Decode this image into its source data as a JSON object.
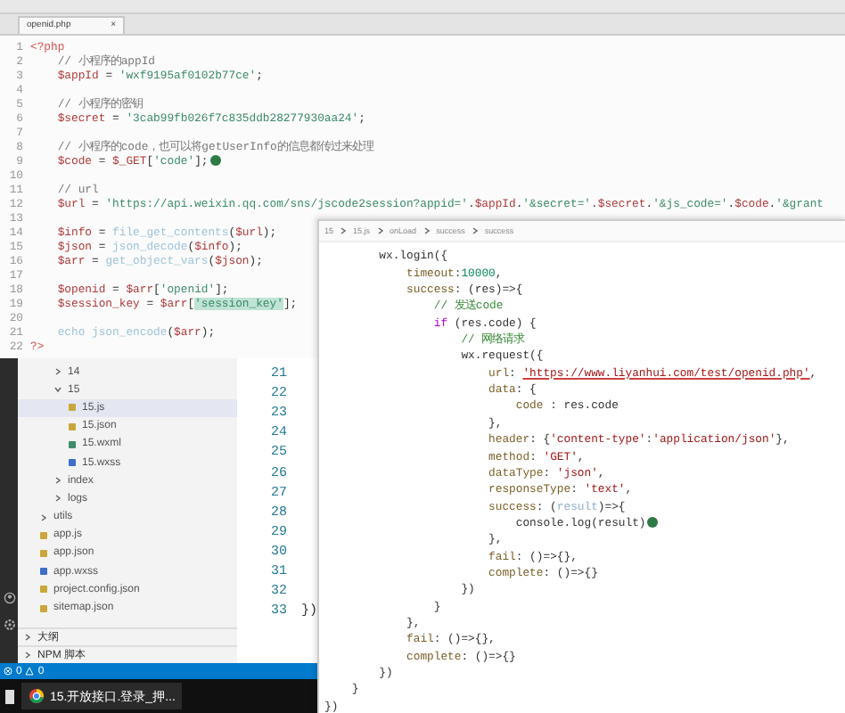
{
  "php_editor": {
    "tab": {
      "label": "openid.php",
      "close": "×"
    },
    "lines": [
      {
        "number": "1",
        "tokens": [
          {
            "kind": "tag",
            "text": "<?php"
          }
        ]
      },
      {
        "number": "2",
        "tokens": [
          {
            "kind": "cmt",
            "text": "    // 小程序的appId"
          }
        ]
      },
      {
        "number": "3",
        "tokens": [
          {
            "kind": "var",
            "text": "    $appId"
          },
          {
            "kind": "plain",
            "text": " = "
          },
          {
            "kind": "str",
            "text": "'wxf9195af0102b77ce'"
          },
          {
            "kind": "plain",
            "text": ";"
          }
        ]
      },
      {
        "number": "4"
      },
      {
        "number": "5",
        "tokens": [
          {
            "kind": "cmt",
            "text": "    // 小程序的密钥"
          }
        ]
      },
      {
        "number": "6",
        "tokens": [
          {
            "kind": "var",
            "text": "    $secret"
          },
          {
            "kind": "plain",
            "text": " = "
          },
          {
            "kind": "str",
            "text": "'3cab99fb026f7c835ddb28277930aa24'"
          },
          {
            "kind": "plain",
            "text": ";"
          }
        ]
      },
      {
        "number": "7"
      },
      {
        "number": "8",
        "tokens": [
          {
            "kind": "cmt",
            "text": "    // 小程序的code，也可以将getUserInfo的信息都传过来处理"
          }
        ]
      },
      {
        "number": "9",
        "tokens": [
          {
            "kind": "var",
            "text": "    $code"
          },
          {
            "kind": "plain",
            "text": " = "
          },
          {
            "kind": "var",
            "text": "$_GET"
          },
          {
            "kind": "plain",
            "text": "["
          },
          {
            "kind": "str",
            "text": "'code'"
          },
          {
            "kind": "plain",
            "text": "];"
          }
        ],
        "cursor": true
      },
      {
        "number": "10"
      },
      {
        "number": "11",
        "tokens": [
          {
            "kind": "cmt",
            "text": "    // url"
          }
        ]
      },
      {
        "number": "12",
        "tokens": [
          {
            "kind": "var",
            "text": "    $url"
          },
          {
            "kind": "plain",
            "text": " = "
          },
          {
            "kind": "str",
            "text": "'https://api.weixin.qq.com/sns/jscode2session?appid='"
          },
          {
            "kind": "plain",
            "text": "."
          },
          {
            "kind": "var",
            "text": "$appId"
          },
          {
            "kind": "plain",
            "text": "."
          },
          {
            "kind": "str",
            "text": "'&secret='"
          },
          {
            "kind": "plain",
            "text": "."
          },
          {
            "kind": "var",
            "text": "$secret"
          },
          {
            "kind": "plain",
            "text": "."
          },
          {
            "kind": "str",
            "text": "'&js_code='"
          },
          {
            "kind": "plain",
            "text": "."
          },
          {
            "kind": "var",
            "text": "$code"
          },
          {
            "kind": "plain",
            "text": "."
          },
          {
            "kind": "str",
            "text": "'&grant"
          }
        ]
      },
      {
        "number": "13"
      },
      {
        "number": "14",
        "tokens": [
          {
            "kind": "var",
            "text": "    $info"
          },
          {
            "kind": "plain",
            "text": " = "
          },
          {
            "kind": "fn",
            "text": "file_get_contents"
          },
          {
            "kind": "plain",
            "text": "("
          },
          {
            "kind": "var",
            "text": "$url"
          },
          {
            "kind": "plain",
            "text": ");"
          }
        ]
      },
      {
        "number": "15",
        "tokens": [
          {
            "kind": "var",
            "text": "    $json"
          },
          {
            "kind": "plain",
            "text": " = "
          },
          {
            "kind": "fn",
            "text": "json_decode"
          },
          {
            "kind": "plain",
            "text": "("
          },
          {
            "kind": "var",
            "text": "$info"
          },
          {
            "kind": "plain",
            "text": ");"
          }
        ]
      },
      {
        "number": "16",
        "tokens": [
          {
            "kind": "var",
            "text": "    $arr"
          },
          {
            "kind": "plain",
            "text": " = "
          },
          {
            "kind": "fn",
            "text": "get_object_vars"
          },
          {
            "kind": "plain",
            "text": "("
          },
          {
            "kind": "var",
            "text": "$json"
          },
          {
            "kind": "plain",
            "text": ");"
          }
        ]
      },
      {
        "number": "17"
      },
      {
        "number": "18",
        "tokens": [
          {
            "kind": "var",
            "text": "    $openid"
          },
          {
            "kind": "plain",
            "text": " = "
          },
          {
            "kind": "var",
            "text": "$arr"
          },
          {
            "kind": "plain",
            "text": "["
          },
          {
            "kind": "str",
            "text": "'openid'"
          },
          {
            "kind": "plain",
            "text": "];"
          }
        ]
      },
      {
        "number": "19",
        "tokens": [
          {
            "kind": "var",
            "text": "    $session_key"
          },
          {
            "kind": "plain",
            "text": " = "
          },
          {
            "kind": "var",
            "text": "$arr"
          },
          {
            "kind": "plain",
            "text": "["
          },
          {
            "kind": "sel",
            "text": "'session_key'"
          },
          {
            "kind": "plain",
            "text": "];"
          }
        ]
      },
      {
        "number": "20"
      },
      {
        "number": "21",
        "tokens": [
          {
            "kind": "fn",
            "text": "    echo json_encode"
          },
          {
            "kind": "plain",
            "text": "("
          },
          {
            "kind": "var",
            "text": "$arr"
          },
          {
            "kind": "plain",
            "text": ");"
          }
        ]
      },
      {
        "number": "22",
        "tokens": [
          {
            "kind": "tag",
            "text": "?>"
          }
        ]
      }
    ]
  },
  "explorer": {
    "nested_items": [
      {
        "label": "14",
        "kind": "folder",
        "expanded": false,
        "selected": false
      },
      {
        "label": "15",
        "kind": "folder",
        "expanded": true,
        "selected": false,
        "children": [
          {
            "label": "15.js",
            "kind": "js",
            "selected": true
          },
          {
            "label": "15.json",
            "kind": "json",
            "selected": false
          },
          {
            "label": "15.wxml",
            "kind": "wxml",
            "selected": false
          },
          {
            "label": "15.wxss",
            "kind": "wxss",
            "selected": false
          }
        ]
      },
      {
        "label": "index",
        "kind": "folder",
        "expanded": false,
        "selected": false
      },
      {
        "label": "logs",
        "kind": "folder",
        "expanded": false,
        "selected": false
      }
    ],
    "items": [
      {
        "label": "utils",
        "kind": "folder",
        "expanded": false,
        "selected": false
      },
      {
        "label": "app.js",
        "kind": "js",
        "selected": false
      },
      {
        "label": "app.json",
        "kind": "json",
        "selected": false
      },
      {
        "label": "app.wxss",
        "kind": "wxss",
        "selected": false
      },
      {
        "label": "project.config.json",
        "kind": "json",
        "selected": false
      },
      {
        "label": "sitemap.json",
        "kind": "json",
        "selected": false
      }
    ],
    "sections": [
      {
        "label": "大纲",
        "expanded": false
      },
      {
        "label": "NPM 脚本",
        "expanded": false
      }
    ]
  },
  "back_editor": {
    "line_numbers": [
      "21",
      "22",
      "23",
      "24",
      "25",
      "26",
      "27",
      "28",
      "29",
      "30",
      "31",
      "32",
      "33"
    ],
    "last_line": "})"
  },
  "status_bar": {
    "errors": "0",
    "warnings": "0"
  },
  "taskbar": {
    "items": [
      {
        "label": "15.开放接口.登录_押..."
      }
    ]
  },
  "js_editor": {
    "breadcrumb": [
      "15",
      "15.js",
      "onLoad",
      "success",
      "success"
    ],
    "lines": [
      {
        "tokens": [
          {
            "kind": "plain",
            "text": "        wx.login({"
          }
        ]
      },
      {
        "tokens": [
          {
            "kind": "prop",
            "text": "            timeout"
          },
          {
            "kind": "plain",
            "text": ":"
          },
          {
            "kind": "num",
            "text": "10000"
          },
          {
            "kind": "plain",
            "text": ","
          }
        ]
      },
      {
        "tokens": [
          {
            "kind": "prop",
            "text": "            success"
          },
          {
            "kind": "plain",
            "text": ": (res)=>{"
          }
        ]
      },
      {
        "tokens": [
          {
            "kind": "cmt",
            "text": "                // 发送code"
          }
        ]
      },
      {
        "tokens": [
          {
            "kind": "kw",
            "text": "                if"
          },
          {
            "kind": "plain",
            "text": " (res.code) {"
          }
        ]
      },
      {
        "tokens": [
          {
            "kind": "cmt",
            "text": "                    // 网络请求"
          }
        ]
      },
      {
        "tokens": [
          {
            "kind": "plain",
            "text": "                    wx.request({"
          }
        ]
      },
      {
        "tokens": [
          {
            "kind": "prop",
            "text": "                        url"
          },
          {
            "kind": "plain",
            "text": ": "
          },
          {
            "kind": "link",
            "text": "'https://www.liyanhui.com/test/openid.php'"
          },
          {
            "kind": "plain",
            "text": ","
          }
        ]
      },
      {
        "tokens": [
          {
            "kind": "prop",
            "text": "                        data"
          },
          {
            "kind": "plain",
            "text": ": {"
          }
        ]
      },
      {
        "tokens": [
          {
            "kind": "prop",
            "text": "                            code"
          },
          {
            "kind": "plain",
            "text": " : res.code"
          }
        ]
      },
      {
        "tokens": [
          {
            "kind": "plain",
            "text": "                        },"
          }
        ]
      },
      {
        "tokens": [
          {
            "kind": "prop",
            "text": "                        header"
          },
          {
            "kind": "plain",
            "text": ": {"
          },
          {
            "kind": "str",
            "text": "'content-type'"
          },
          {
            "kind": "plain",
            "text": ":"
          },
          {
            "kind": "str",
            "text": "'application/json'"
          },
          {
            "kind": "plain",
            "text": "},"
          }
        ]
      },
      {
        "tokens": [
          {
            "kind": "prop",
            "text": "                        method"
          },
          {
            "kind": "plain",
            "text": ": "
          },
          {
            "kind": "str",
            "text": "'GET'"
          },
          {
            "kind": "plain",
            "text": ","
          }
        ]
      },
      {
        "tokens": [
          {
            "kind": "prop",
            "text": "                        dataType"
          },
          {
            "kind": "plain",
            "text": ": "
          },
          {
            "kind": "str",
            "text": "'json'"
          },
          {
            "kind": "plain",
            "text": ","
          }
        ]
      },
      {
        "tokens": [
          {
            "kind": "prop",
            "text": "                        responseType"
          },
          {
            "kind": "plain",
            "text": ": "
          },
          {
            "kind": "str",
            "text": "'text'"
          },
          {
            "kind": "plain",
            "text": ","
          }
        ]
      },
      {
        "tokens": [
          {
            "kind": "prop",
            "text": "                        success"
          },
          {
            "kind": "plain",
            "text": ": ("
          },
          {
            "kind": "fn",
            "text": "result"
          },
          {
            "kind": "plain",
            "text": ")=>{"
          }
        ]
      },
      {
        "tokens": [
          {
            "kind": "plain",
            "text": "                            console.log(result)"
          }
        ],
        "cursor": true
      },
      {
        "tokens": [
          {
            "kind": "plain",
            "text": "                        },"
          }
        ]
      },
      {
        "tokens": [
          {
            "kind": "prop",
            "text": "                        fail"
          },
          {
            "kind": "plain",
            "text": ": ()=>{},"
          }
        ]
      },
      {
        "tokens": [
          {
            "kind": "prop",
            "text": "                        complete"
          },
          {
            "kind": "plain",
            "text": ": ()=>{}"
          }
        ]
      },
      {
        "tokens": [
          {
            "kind": "plain",
            "text": "                    })"
          }
        ]
      },
      {
        "tokens": [
          {
            "kind": "plain",
            "text": "                }"
          }
        ]
      },
      {
        "tokens": [
          {
            "kind": "plain",
            "text": "            },"
          }
        ]
      },
      {
        "tokens": [
          {
            "kind": "prop",
            "text": "            fail"
          },
          {
            "kind": "plain",
            "text": ": ()=>{},"
          }
        ]
      },
      {
        "tokens": [
          {
            "kind": "prop",
            "text": "            complete"
          },
          {
            "kind": "plain",
            "text": ": ()=>{}"
          }
        ]
      },
      {
        "tokens": [
          {
            "kind": "plain",
            "text": "        })"
          }
        ]
      },
      {
        "tokens": [
          {
            "kind": "plain",
            "text": "    }"
          }
        ]
      },
      {
        "tokens": [
          {
            "kind": "plain",
            "text": "})"
          }
        ]
      }
    ]
  }
}
